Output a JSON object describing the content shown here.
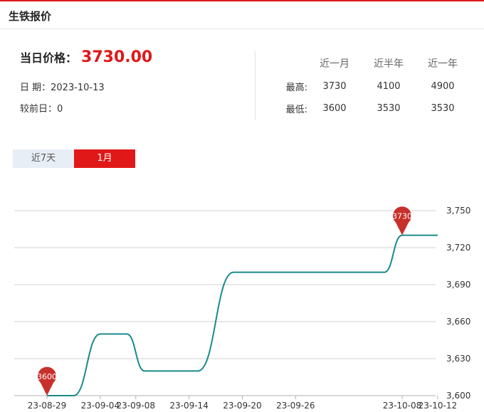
{
  "header": {
    "title": "生铁报价"
  },
  "summary": {
    "price_label": "当日价格：",
    "price_value": "3730.00",
    "date_text": "日 期：2023-10-13",
    "change_text": "较前日：0"
  },
  "stats": {
    "columns": [
      "近一月",
      "近半年",
      "近一年"
    ],
    "rows": [
      {
        "label": "最高:",
        "values": [
          "3730",
          "4100",
          "4900"
        ]
      },
      {
        "label": "最低:",
        "values": [
          "3600",
          "3530",
          "3530"
        ]
      }
    ]
  },
  "tabs": [
    {
      "label": "近7天",
      "active": false
    },
    {
      "label": "1月",
      "active": true
    }
  ],
  "colors": {
    "accent": "#e01818",
    "line": "#1a8a8a",
    "marker": "#c8302c"
  },
  "chart_data": {
    "type": "line",
    "x": [
      "23-08-29",
      "23-09-01",
      "23-09-04",
      "23-09-05",
      "23-09-07",
      "23-09-09",
      "23-09-11",
      "23-09-14",
      "23-09-15",
      "23-09-19",
      "23-09-20",
      "23-09-26",
      "23-10-06",
      "23-10-08",
      "23-10-12"
    ],
    "values": [
      3600,
      3600,
      3650,
      3650,
      3650,
      3620,
      3620,
      3620,
      3620,
      3700,
      3700,
      3700,
      3700,
      3730,
      3730
    ],
    "x_ticks": [
      "23-08-29",
      "23-09-04",
      "23-09-08",
      "23-09-14",
      "23-09-20",
      "23-09-26",
      "23-10-08",
      "23-10-12"
    ],
    "y_ticks": [
      "3,600",
      "3,630",
      "3,660",
      "3,690",
      "3,720",
      "3,750"
    ],
    "ylim": [
      3600,
      3750
    ],
    "markers": [
      {
        "x": "23-08-29",
        "value": 3600,
        "label": "3600"
      },
      {
        "x": "23-10-08",
        "value": 3730,
        "label": "3730"
      }
    ],
    "grid": true
  }
}
